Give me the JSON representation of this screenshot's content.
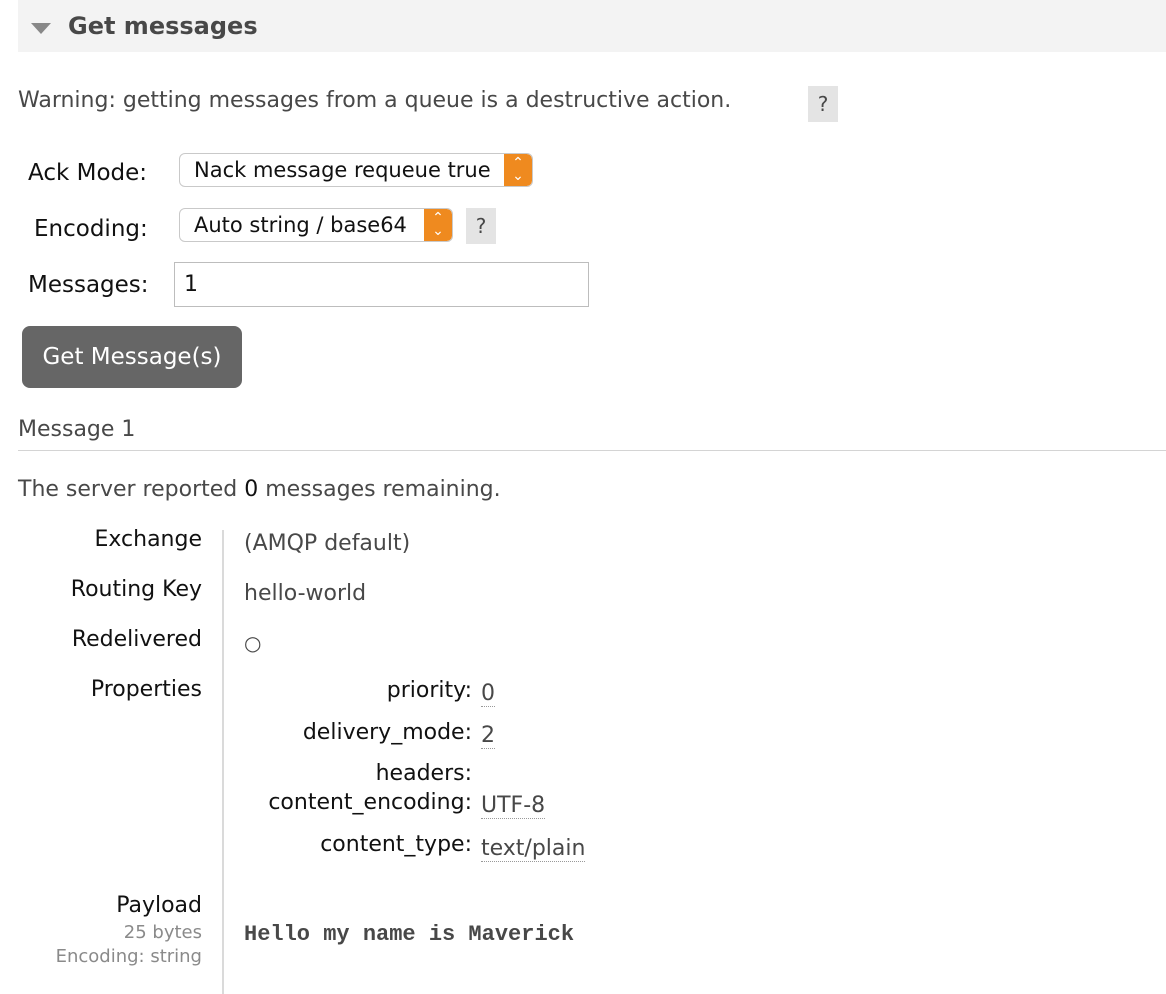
{
  "section": {
    "title": "Get messages"
  },
  "warning": {
    "text": "Warning: getting messages from a queue is a destructive action.",
    "help": "?"
  },
  "form": {
    "ack_mode_label": "Ack Mode:",
    "ack_mode_value": "Nack message requeue true",
    "encoding_label": "Encoding:",
    "encoding_value": "Auto string / base64",
    "encoding_help": "?",
    "messages_label": "Messages:",
    "messages_value": "1",
    "submit_label": "Get Message(s)"
  },
  "message": {
    "title": "Message 1",
    "remaining_prefix": "The server reported ",
    "remaining_count": "0",
    "remaining_suffix": " messages remaining.",
    "exchange_label": "Exchange",
    "exchange_value": "(AMQP default)",
    "routing_key_label": "Routing Key",
    "routing_key_value": "hello-world",
    "redelivered_label": "Redelivered",
    "redelivered_value": "○",
    "properties_label": "Properties",
    "properties": {
      "priority_key": "priority:",
      "priority_value": "0",
      "delivery_mode_key": "delivery_mode:",
      "delivery_mode_value": "2",
      "headers_key": "headers:",
      "content_encoding_key": "content_encoding:",
      "content_encoding_value": "UTF-8",
      "content_type_key": "content_type:",
      "content_type_value": "text/plain"
    },
    "payload_label": "Payload",
    "payload_size": "25 bytes",
    "payload_encoding": "Encoding: string",
    "payload_value": "Hello my name is Maverick"
  },
  "colors": {
    "accent": "#ef8a1f",
    "button": "#666666",
    "header_bg": "#f3f3f3"
  }
}
